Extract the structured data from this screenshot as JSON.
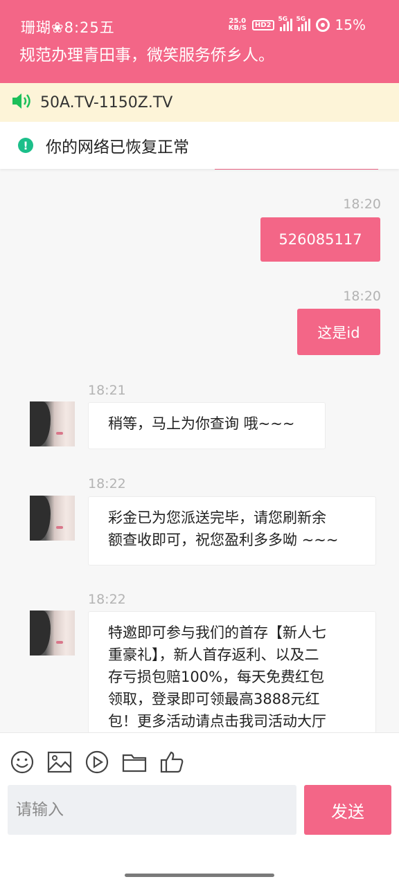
{
  "status_bar": {
    "left_text": "珊瑚❀8:25五",
    "speed_value": "25.0",
    "speed_unit": "KB/S",
    "hd_label": "HD2",
    "signal1_label": "5G",
    "signal2_label": "5G",
    "battery_percent": "15%"
  },
  "header": {
    "title": "规范办理青田事，微笑服务侨乡人。"
  },
  "notice": {
    "text": "50A.TV-1150Z.TV",
    "icon": "speaker-icon"
  },
  "network": {
    "text": "你的网络已恢复正常",
    "icon": "check-circle-icon",
    "color": "#1cbf8a"
  },
  "messages": [
    {
      "direction": "out",
      "time": "18:20",
      "text": "526085117"
    },
    {
      "direction": "out",
      "time": "18:20",
      "text": "这是id"
    },
    {
      "direction": "in",
      "time": "18:21",
      "text": "稍等，马上为你查询 哦~~~"
    },
    {
      "direction": "in",
      "time": "18:22",
      "lines": [
        "彩金已为您派送完毕，请您刷新余",
        "额查收即可，祝您盈利多多呦 ~~~"
      ]
    },
    {
      "direction": "in",
      "time": "18:22",
      "lines": [
        "特邀即可参与我们的首存【新人七",
        "重豪礼】，新人首存返利、以及二",
        "存亏损包赔100%，每天免费红包",
        "领取，登录即可领最高3888元红",
        "包！更多活动请点击我司活动大厅"
      ]
    }
  ],
  "toolbar": {
    "icons": [
      "emoji-icon",
      "image-icon",
      "video-icon",
      "folder-icon",
      "thumbs-up-icon"
    ]
  },
  "composer": {
    "placeholder": "请输入",
    "value": "",
    "send_label": "发送"
  },
  "colors": {
    "accent": "#f36687",
    "notice_bg": "#fdf4d8",
    "chat_bg": "#f7f7f7"
  }
}
